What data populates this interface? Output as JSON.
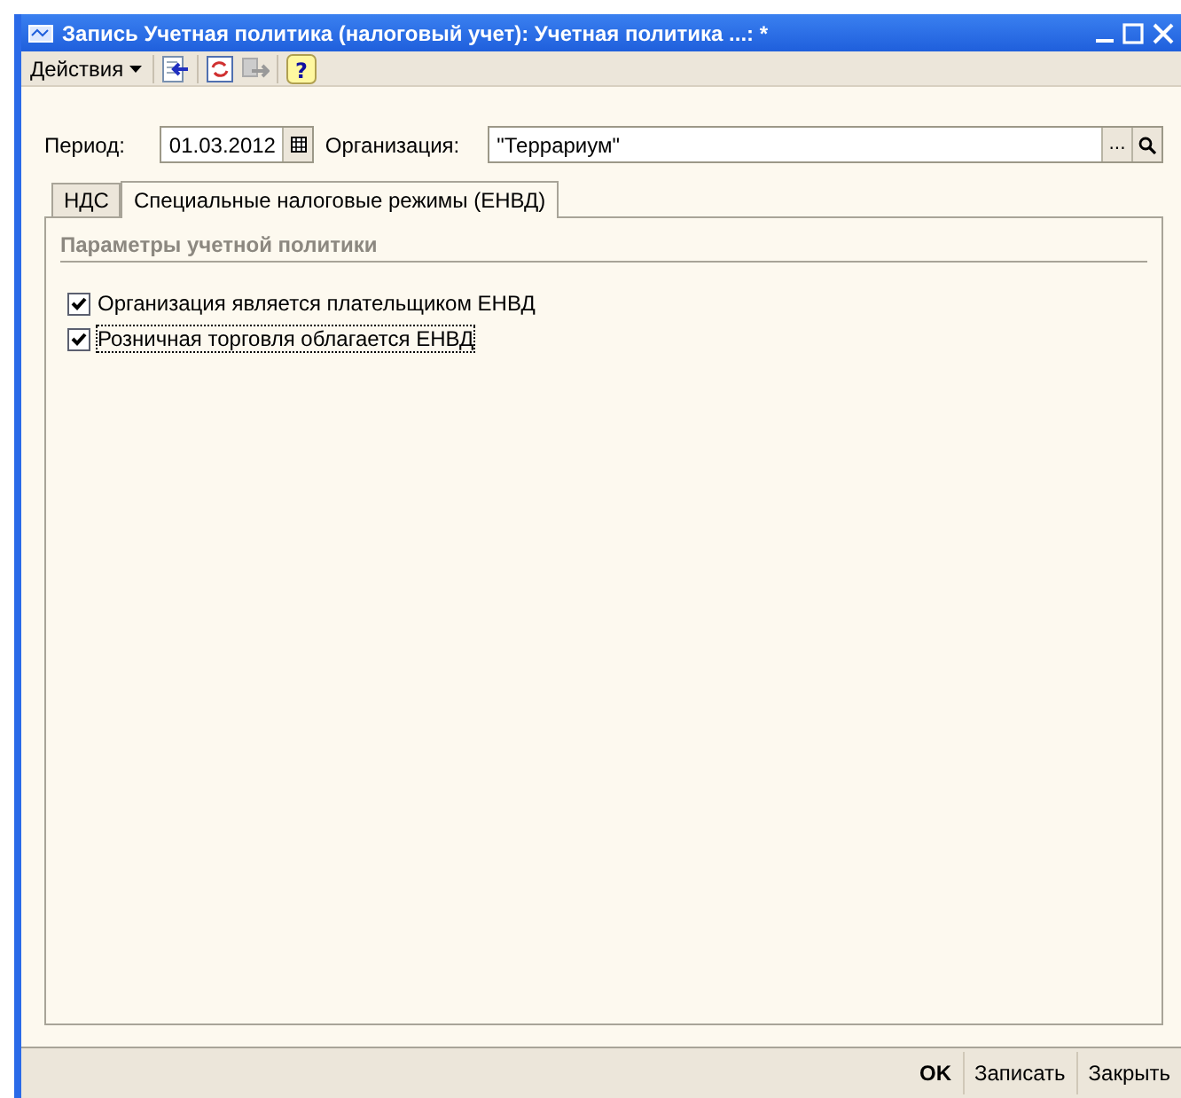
{
  "window": {
    "title": "Запись Учетная политика (налоговый учет): Учетная политика ...: *"
  },
  "toolbar": {
    "actions_label": "Действия",
    "help_glyph": "?"
  },
  "form": {
    "period_label": "Период:",
    "period_value": "01.03.2012",
    "organization_label": "Организация:",
    "organization_value": "\"Террариум\"",
    "select_button": "..."
  },
  "tabs": [
    {
      "label": "НДС",
      "selected": false
    },
    {
      "label": "Специальные налоговые режимы (ЕНВД)",
      "selected": true
    }
  ],
  "section_title": "Параметры учетной политики",
  "options": [
    {
      "label": "Организация является плательщиком ЕНВД",
      "checked": true,
      "focused": false
    },
    {
      "label": "Розничная торговля облагается ЕНВД",
      "checked": true,
      "focused": true
    }
  ],
  "buttons": [
    {
      "label": "OK",
      "default": true
    },
    {
      "label": "Записать",
      "default": false
    },
    {
      "label": "Закрыть",
      "default": false
    }
  ]
}
